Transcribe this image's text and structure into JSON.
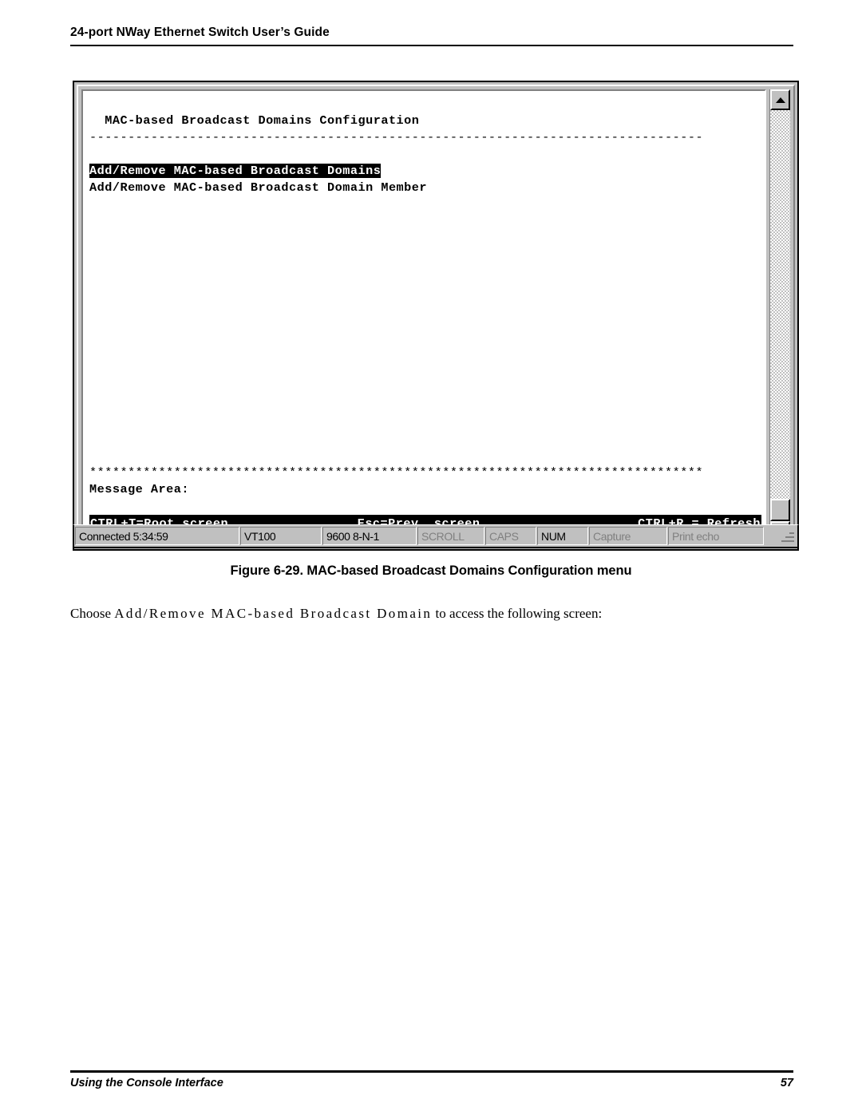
{
  "page": {
    "header_title": "24-port NWay Ethernet Switch User’s Guide",
    "footer_left": "Using the Console Interface",
    "footer_page_number": "57"
  },
  "terminal": {
    "title": "  MAC-based Broadcast Domains Configuration",
    "separator": "--------------------------------------------------------------------------------",
    "menu_items": [
      {
        "label": "Add/Remove MAC-based Broadcast Domains",
        "highlighted": true
      },
      {
        "label": "Add/Remove MAC-based Broadcast Domain Member",
        "highlighted": false
      }
    ],
    "asterisk_rule": "********************************************************************************",
    "message_area_label": "Message Area:",
    "hints": {
      "root": "CTRL+T=Root screen",
      "prev": "Esc=Prev. screen",
      "refresh": "CTRL+R = Refresh"
    }
  },
  "scrollbar": {
    "up_arrow": "scroll-up",
    "down_arrow": "scroll-down"
  },
  "status_bar": {
    "connected": "Connected 5:34:59",
    "emulation": "VT100",
    "line_settings": "9600 8-N-1",
    "indicators": [
      {
        "label": "SCROLL",
        "active": false
      },
      {
        "label": "CAPS",
        "active": false
      },
      {
        "label": "NUM",
        "active": true
      },
      {
        "label": "Capture",
        "active": false
      },
      {
        "label": "Print echo",
        "active": false
      }
    ]
  },
  "figure": {
    "caption": "Figure 6-29.  MAC-based Broadcast Domains Configuration menu"
  },
  "paragraph": {
    "lead": "Choose ",
    "emphasis": "Add/Remove MAC-based Broadcast Domain",
    "tail": " to access the following screen:"
  }
}
